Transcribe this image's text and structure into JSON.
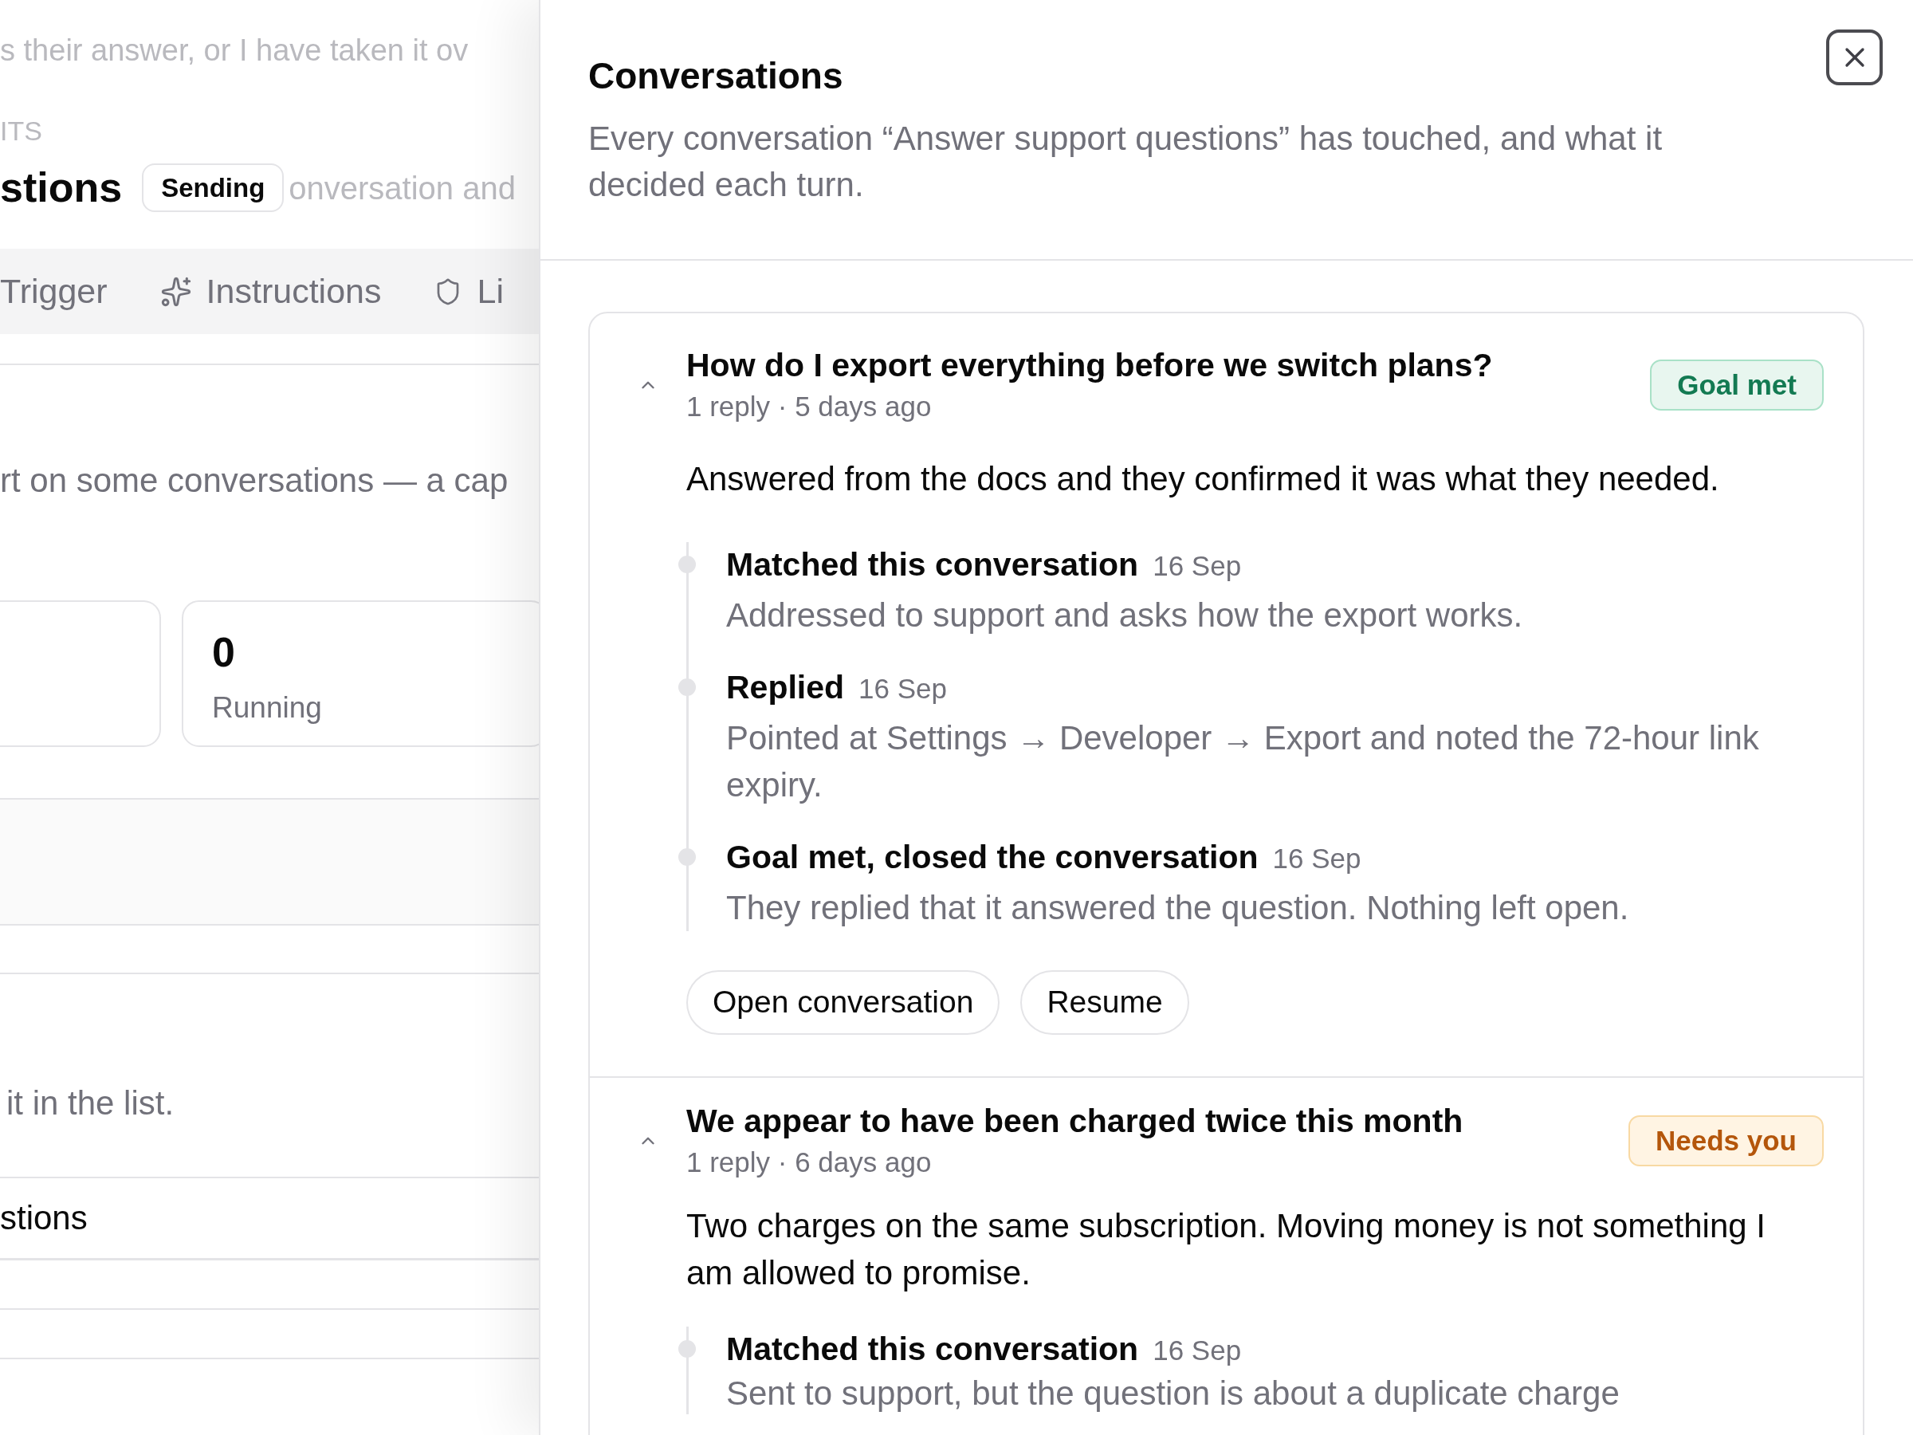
{
  "background_page": {
    "faded_texts": [
      "s their answer, or I have taken it ov",
      "ITS"
    ],
    "title": "stions",
    "status_badge": "Sending",
    "faded_heading_text": "onversation and",
    "tabs": [
      {
        "label": "Trigger",
        "selected": false
      },
      {
        "label": "Instructions",
        "selected": false
      },
      {
        "label": "Li",
        "selected": false
      }
    ],
    "description": "rt on some conversations — a cap",
    "stats": [
      {
        "value": "0",
        "label": "Running"
      }
    ],
    "note": "it in the list.",
    "list_rows": [
      "stions"
    ]
  },
  "drawer": {
    "title": "Conversations",
    "description": "Every conversation “Answer support questions” has touched, and what it decided each turn.",
    "conversations": [
      {
        "title": "How do I export everything before we switch plans?",
        "meta": "1 reply · 5 days ago",
        "expanded": true,
        "status": {
          "label": "Goal met",
          "kind": "success"
        },
        "summary": "Answered from the docs and they confirmed it was what they needed.",
        "events": [
          {
            "title": "Matched this conversation",
            "date": "16 Sep",
            "detail": "Addressed to support and asks how the export works."
          },
          {
            "title": "Replied",
            "date": "16 Sep",
            "detail": "Pointed at Settings → Developer → Export and noted the 72-hour link expiry."
          },
          {
            "title": "Goal met, closed the conversation",
            "date": "16 Sep",
            "detail": "They replied that it answered the question. Nothing left open."
          }
        ],
        "actions": [
          "Open conversation",
          "Resume"
        ]
      },
      {
        "title": "We appear to have been charged twice this month",
        "meta": "1 reply · 6 days ago",
        "expanded": true,
        "status": {
          "label": "Needs you",
          "kind": "warning"
        },
        "summary": "Two charges on the same subscription. Moving money is not something I am allowed to promise.",
        "events": [
          {
            "title": "Matched this conversation",
            "date": "16 Sep",
            "detail": "Sent to support, but the question is about a duplicate charge"
          }
        ]
      }
    ]
  }
}
